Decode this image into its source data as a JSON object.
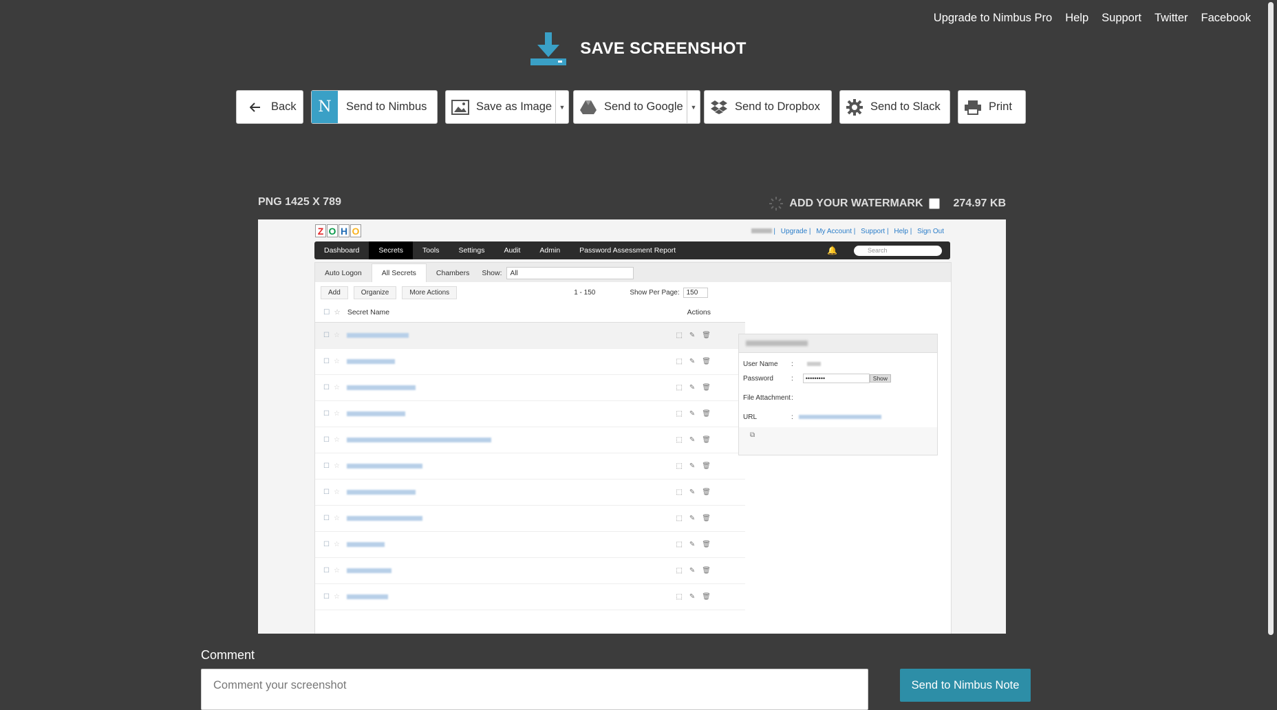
{
  "nav": {
    "links": [
      "Upgrade to Nimbus Pro",
      "Help",
      "Support",
      "Twitter",
      "Facebook"
    ]
  },
  "header": {
    "title": "SAVE SCREENSHOT",
    "icon": "download-icon",
    "accent": "#3aa0c6"
  },
  "toolbar": {
    "back": "Back",
    "send_nimbus": "Send to Nimbus",
    "save_image": "Save as Image",
    "send_google": "Send to Google",
    "send_dropbox": "Send to Dropbox",
    "send_slack": "Send to Slack",
    "print": "Print"
  },
  "image_info": {
    "format": "PNG 1425 X 789",
    "watermark_label": "ADD YOUR WATERMARK",
    "file_size": "274.97 KB"
  },
  "preview": {
    "logo": "ZOHO",
    "top_links": [
      "Upgrade",
      "My Account",
      "Support",
      "Help",
      "Sign Out"
    ],
    "nav_items": [
      "Dashboard",
      "Secrets",
      "Tools",
      "Settings",
      "Audit",
      "Admin",
      "Password Assessment Report"
    ],
    "search_placeholder": "Search",
    "tabs": [
      "Auto Logon",
      "All Secrets",
      "Chambers"
    ],
    "show_label": "Show:",
    "show_value": "All",
    "actions": [
      "Add",
      "Organize",
      "More Actions"
    ],
    "pagination": "1 - 150",
    "per_page_label": "Show Per Page:",
    "per_page_value": "150",
    "col_secret_name": "Secret Name",
    "col_actions": "Actions",
    "detail_fields": [
      "User Name",
      "Password",
      "File Attachment",
      "URL"
    ],
    "password_mask": "•••••••••",
    "show_btn": "Show"
  },
  "comment": {
    "label": "Comment",
    "placeholder": "Comment your screenshot"
  },
  "send_note": "Send to Nimbus Note",
  "colors": {
    "bg": "#3c3c3c",
    "note_button": "#2d8ea7"
  }
}
